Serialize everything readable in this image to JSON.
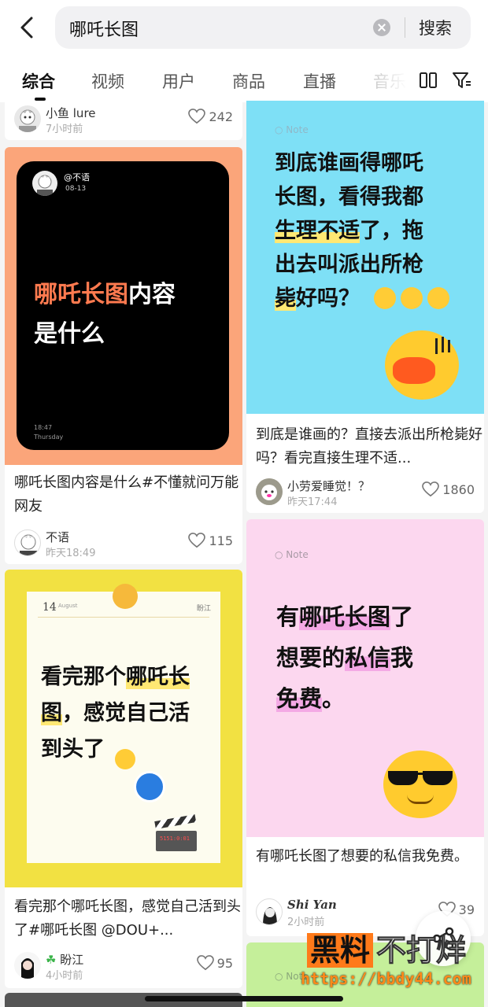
{
  "search": {
    "query": "哪吒长图",
    "button": "搜索"
  },
  "tabs": [
    "综合",
    "视频",
    "用户",
    "商品",
    "直播",
    "音乐"
  ],
  "cards": {
    "top_left": {
      "user": "小鱼 lure",
      "time": "7小时前",
      "likes": "242"
    },
    "card1": {
      "image_username": "@不语",
      "image_date": "08-13",
      "image_title_hl": "哪吒长图",
      "image_title_rest": "内容",
      "image_title_line2": "是什么",
      "image_clock": "18:47",
      "image_day": "Thursday",
      "title": "哪吒长图内容是什么#不懂就问万能网友",
      "user": "不语",
      "time": "昨天18:49",
      "likes": "115"
    },
    "card2": {
      "note_label": "Note",
      "image_line1": "到底谁画得哪吒",
      "image_line2": "长图，看得我都",
      "image_line3_hl": "生理不适",
      "image_line3_rest": "了，拖",
      "image_line4": "出去叫派出所枪",
      "image_line5_hl": "毙",
      "image_line5_rest": "好吗？",
      "title": "到底是谁画的？直接去派出所枪毙好吗？看完直接生理不适...",
      "user": "小劳爱睡觉！？",
      "time": "昨天17:44",
      "likes": "1860"
    },
    "card3": {
      "image_day": "14",
      "image_month": "August",
      "image_author": "盼江",
      "image_line1_a": "看完那个",
      "image_line1_hl": "哪吒长",
      "image_line2_hl": "图",
      "image_line2_rest": "，感觉自己活",
      "image_line3": "到头了",
      "clapper_text": "5151:0:01",
      "title": "看完那个哪吒长图，感觉自己活到头了#哪吒长图 @DOU+...",
      "user": "盼江",
      "time": "4小时前",
      "likes": "95"
    },
    "card4": {
      "note_label": "Note",
      "image_line1_a": "有",
      "image_line1_hl": "哪吒长图",
      "image_line1_rest": "了",
      "image_line2_a": "想要的",
      "image_line2_hl": "私信",
      "image_line2_rest": "我",
      "image_line3_hl": "免费",
      "image_line3_rest": "。",
      "title": "有哪吒长图了想要的私信我免费。",
      "user": "Shi Yan",
      "time": "2小时前",
      "likes": "39"
    },
    "card5": {
      "note_label": "Note"
    }
  },
  "watermark": {
    "brand_a": "黑料",
    "brand_b": "不打烊",
    "url": "https://bbdy44.com"
  },
  "colors": {
    "orange_frame": "#fba57a",
    "cyan_bg": "#7ee0f6",
    "yellow_frame": "#f2e142",
    "pink_bg": "#fcd7ef",
    "green_bg": "#c5ef9a"
  }
}
